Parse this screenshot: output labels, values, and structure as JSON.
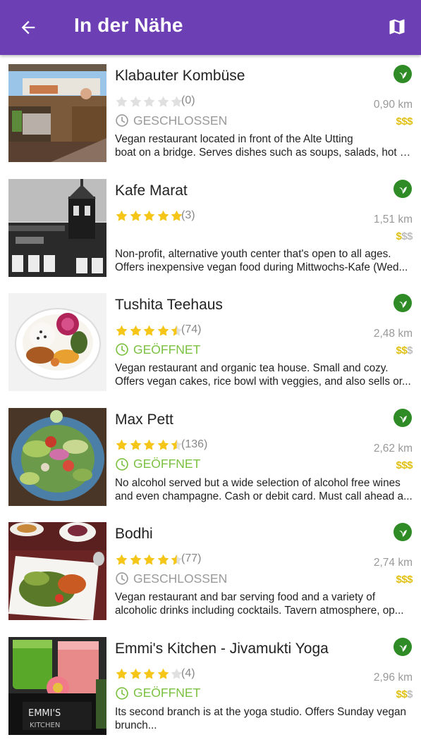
{
  "appbar": {
    "title": "In der Nähe"
  },
  "colors": {
    "appbar": "#6c3fb5",
    "star_on": "#f5c518",
    "star_off": "#e0e0e0",
    "open": "#7cc142",
    "closed": "#9a9a9a",
    "price_on": "#e2c013",
    "price_off": "#bdbdbd",
    "vegan_badge": "#2e8b25"
  },
  "restaurants": [
    {
      "name": "Klabauter Kombüse",
      "rating": 0,
      "review_count": "(0)",
      "status": "GESCHLOSSEN",
      "is_open": false,
      "distance": "0,90 km",
      "price_level": 3,
      "price_symbols": "$$$",
      "description_lines": [
        "Vegan restaurant located in front of the Alte Utting",
        "boat on a bridge. Serves dishes such as soups, salads, hot d..."
      ],
      "badge_icon": "vegan-leaf-icon",
      "thumb": "boat-deck-photo"
    },
    {
      "name": "Kafe Marat",
      "rating": 5,
      "review_count": "(3)",
      "status": "",
      "is_open": null,
      "distance": "1,51 km",
      "price_level": 1,
      "price_symbols": "$$$",
      "description_lines": [
        "Non-profit, alternative youth center that's open to all ages.",
        "Offers inexpensive vegan food during Mittwochs-Kafe (Wed..."
      ],
      "badge_icon": "vegan-leaf-icon",
      "thumb": "building-tower-photo"
    },
    {
      "name": "Tushita Teehaus",
      "rating": 4.5,
      "review_count": "(74)",
      "status": "GEÖFFNET",
      "is_open": true,
      "distance": "2,48 km",
      "price_level": 2,
      "price_symbols": "$$$",
      "description_lines": [
        "Vegan restaurant and organic tea house. Small and cozy.",
        "Offers vegan cakes, rice bowl with veggies, and also sells or..."
      ],
      "badge_icon": "vegan-leaf-icon",
      "thumb": "rice-bowl-photo"
    },
    {
      "name": "Max Pett",
      "rating": 4.5,
      "review_count": "(136)",
      "status": "GEÖFFNET",
      "is_open": true,
      "distance": "2,62 km",
      "price_level": 3,
      "price_symbols": "$$$",
      "description_lines": [
        "No alcohol served but a wide selection of alcohol free wines",
        "and even champagne. Cash or debit card. Must call ahead a..."
      ],
      "badge_icon": "vegan-leaf-icon",
      "thumb": "salad-plate-photo"
    },
    {
      "name": "Bodhi",
      "rating": 4.5,
      "review_count": "(77)",
      "status": "GESCHLOSSEN",
      "is_open": false,
      "distance": "2,74 km",
      "price_level": 3,
      "price_symbols": "$$$",
      "description_lines": [
        "Vegan restaurant and bar serving food and a variety of",
        "alcoholic drinks including cocktails. Tavern atmosphere, op..."
      ],
      "badge_icon": "vegan-leaf-icon",
      "thumb": "table-dishes-photo"
    },
    {
      "name": "Emmi's Kitchen - Jivamukti Yoga",
      "rating": 4,
      "review_count": "(4)",
      "status": "GEÖFFNET",
      "is_open": true,
      "distance": "2,96 km",
      "price_level": 2,
      "price_symbols": "$$$",
      "description_lines": [
        "Its second branch is at the yoga studio. Offers Sunday vegan",
        "brunch..."
      ],
      "badge_icon": "vegan-leaf-icon",
      "thumb": "smoothies-photo"
    }
  ]
}
